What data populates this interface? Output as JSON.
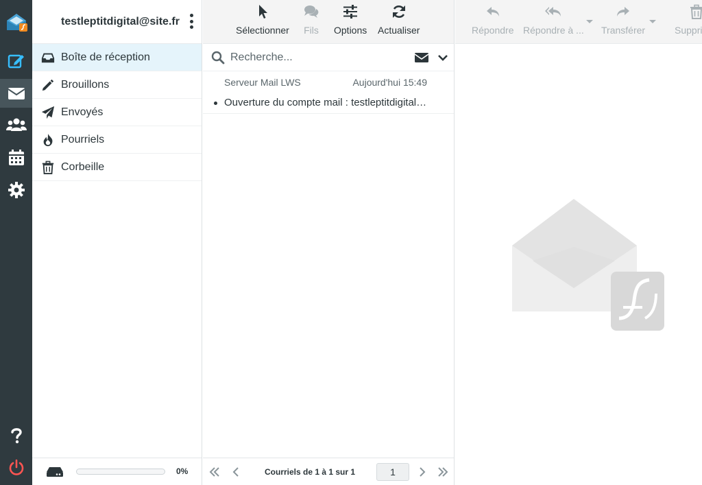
{
  "account": {
    "email": "testleptitdigital@site.fr"
  },
  "rail": {
    "items": [
      "app-logo",
      "compose",
      "mail",
      "contacts",
      "calendar",
      "settings",
      "help",
      "logout"
    ]
  },
  "folders": [
    {
      "label": "Boîte de réception",
      "icon": "inbox-icon",
      "selected": true
    },
    {
      "label": "Brouillons",
      "icon": "pencil-icon",
      "selected": false
    },
    {
      "label": "Envoyés",
      "icon": "paper-plane-icon",
      "selected": false
    },
    {
      "label": "Pourriels",
      "icon": "fire-icon",
      "selected": false
    },
    {
      "label": "Corbeille",
      "icon": "trash-icon",
      "selected": false
    }
  ],
  "quota": {
    "percent_label": "0%",
    "fraction": 0.0
  },
  "list_toolbar": {
    "select": "Sélectionner",
    "threads": "Fils",
    "options": "Options",
    "refresh": "Actualiser"
  },
  "search": {
    "placeholder": "Recherche..."
  },
  "messages": [
    {
      "from": "Serveur Mail LWS",
      "date": "Aujourd'hui 15:49",
      "subject": "Ouverture du compte mail : testleptitdigital@site.fr",
      "unread": true
    }
  ],
  "pagination": {
    "count": "Courriels de 1 à 1 sur 1",
    "page": "1"
  },
  "content_toolbar": {
    "reply": "Répondre",
    "reply_all": "Répondre à ...",
    "forward": "Transférer",
    "delete": "Supprimer"
  },
  "colors": {
    "accent": "#37beff",
    "rail_bg": "#2f3a3f",
    "logout": "#ff5552",
    "selected_bg": "#e5f4fb"
  }
}
